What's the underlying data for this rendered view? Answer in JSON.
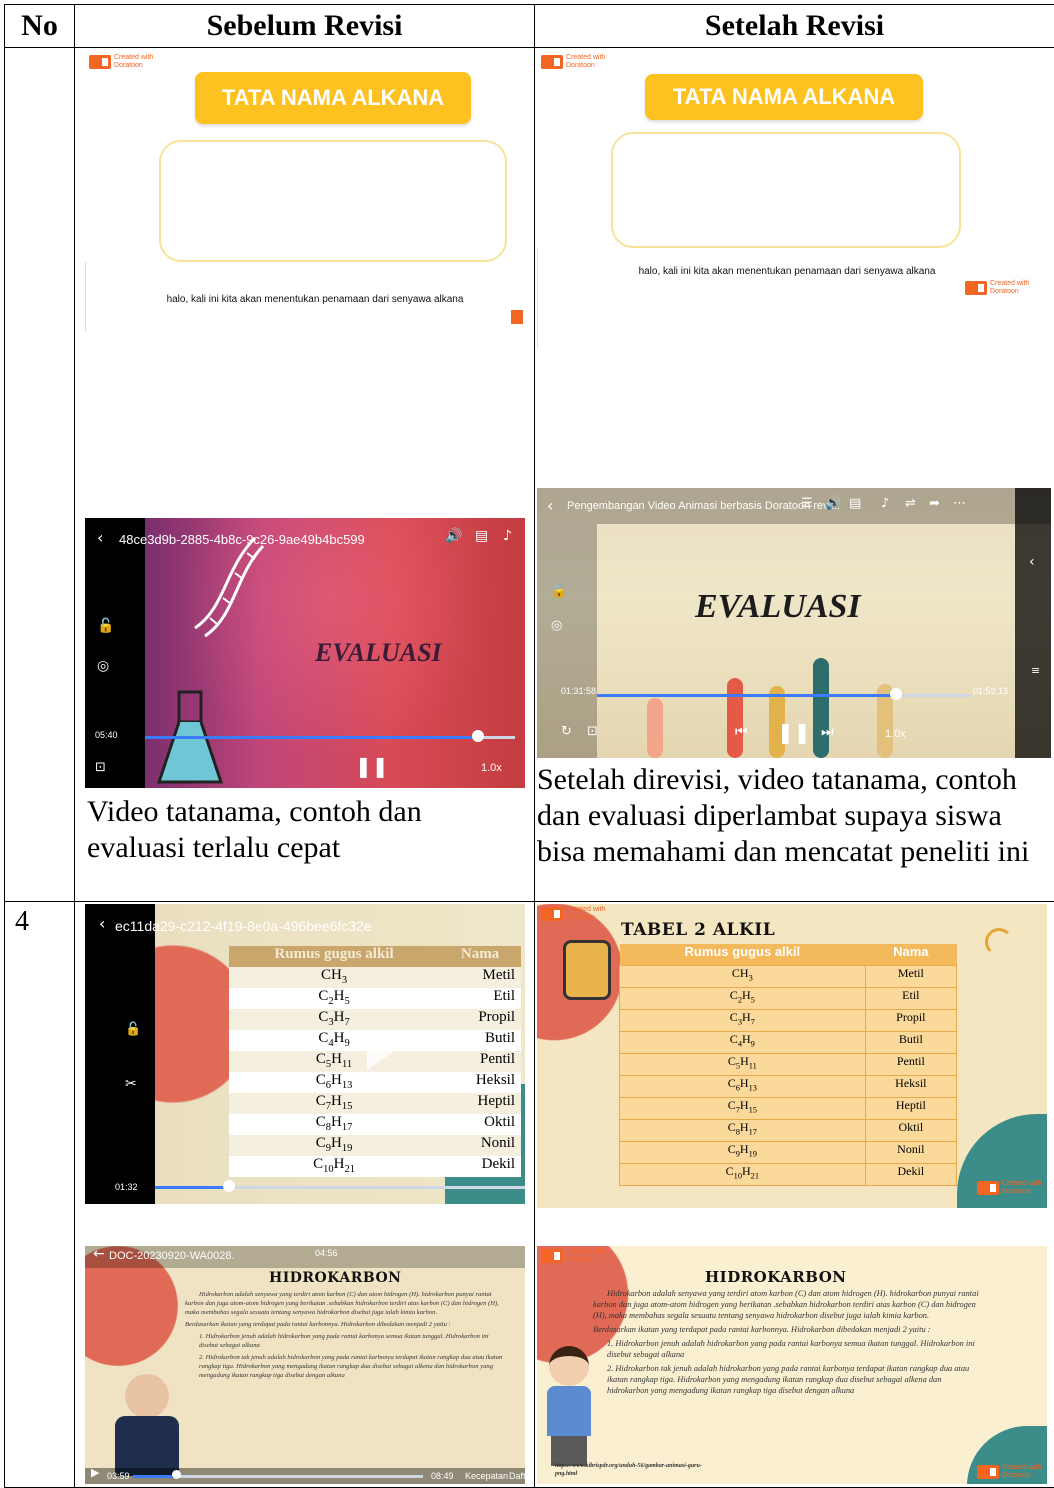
{
  "headers": {
    "no": "No",
    "before": "Sebelum Revisi",
    "after": "Setelah Revisi"
  },
  "row3": {
    "before": {
      "slide": {
        "logo_small": "Created with",
        "logo_name": "Doratoon",
        "title": "TATA NAMA ALKANA",
        "caption": "halo, kali ini kita akan menentukan penamaan dari senyawa alkana"
      },
      "video": {
        "file": "48ce3d9b-2885-4b8c-9c26-9ae49b4bc599",
        "heading": "EVALUASI",
        "time": "05:40",
        "speed": "1.0x",
        "progress": 0.9
      },
      "description": "Video tatanama, contoh dan evaluasi terlalu cepat"
    },
    "after": {
      "slide": {
        "logo_small": "Created with",
        "logo_name": "Doratoon",
        "title": "TATA NAMA ALKANA",
        "caption": "halo, kali ini kita akan menentukan penamaan dari senyawa alkana"
      },
      "video": {
        "file": "Pengembangan Video Animasi berbasis Doratoon revi...",
        "heading": "EVALUASI",
        "time_current": "01:31:58",
        "time_total": "01:53:13",
        "speed": "1.0x",
        "progress": 0.8
      },
      "description": "Setelah direvisi, video tatanama, contoh dan evaluasi diperlambat supaya siswa bisa memahami dan mencatat peneliti ini"
    }
  },
  "row4": {
    "number": "4",
    "alkyl_table": {
      "header": [
        "Rumus gugus alkil",
        "Nama"
      ],
      "rows": [
        [
          "CH3",
          "Metil"
        ],
        [
          "C2H5",
          "Etil"
        ],
        [
          "C3H7",
          "Propil"
        ],
        [
          "C4H9",
          "Butil"
        ],
        [
          "C5H11",
          "Pentil"
        ],
        [
          "C6H13",
          "Heksil"
        ],
        [
          "C7H15",
          "Heptil"
        ],
        [
          "C8H17",
          "Oktil"
        ],
        [
          "C9H19",
          "Nonil"
        ],
        [
          "C10H21",
          "Dekil"
        ]
      ]
    },
    "before": {
      "video1": {
        "file": "ec11da29-c212-4f19-8e0a-496bee6fc32e",
        "time": "01:32",
        "progress": 0.2
      },
      "video2": {
        "file": "DOC-20230920-WA0028.",
        "clock": "04:56",
        "time": "03:59",
        "total": "08:49",
        "speed_label": "Kecepatan",
        "list_label": "Dafta",
        "progress": 0.15
      }
    },
    "after": {
      "table_title": "TABEL 2 ALKIL",
      "source": "https://www.kibrispdr.org/unduh-56/gambar-animasi-guru-png.html"
    },
    "hydrocarbon": {
      "title": "HIDROKARBON",
      "p1": "Hidrokarbon adalah senyawa yang terdiri atom karbon (C) dan atom hidrogen (H). hidrokarbon punyai rantai karbon dan juga atom-atom hidrogen yang berikatan .sebabkan hidrokarbon terdiri atas karbon (C) dan hidrogen (H), maka membahas segala sesuatu tentang senyawa hidrokarbon disebut juga ialah kimia karbon.",
      "p2": "Berdasarkan ikatan yang terdapat pada rantai karbonnya. Hidrokarbon dibedakan menjadi 2 yaitu :",
      "li1": "1.   Hidrokarbon jenuh adalah hidrokarbon yang pada rantai karbonya semua ikatan tunggal. Hidrokarbon ini disebut sebagai alkana",
      "li2": "2.   Hidrokarbon tak jenuh adalah hidrokarbon yang pada rantai karbonya terdapat ikatan rangkap dua atau ikatan rangkap tiga. Hidrokarbon yang mengadung ikatan rangkap dua disebut sebagai alkena dan hidrokarbon yang mengadung ikatan rangkap tiga disebut dengan alkuna"
    }
  }
}
